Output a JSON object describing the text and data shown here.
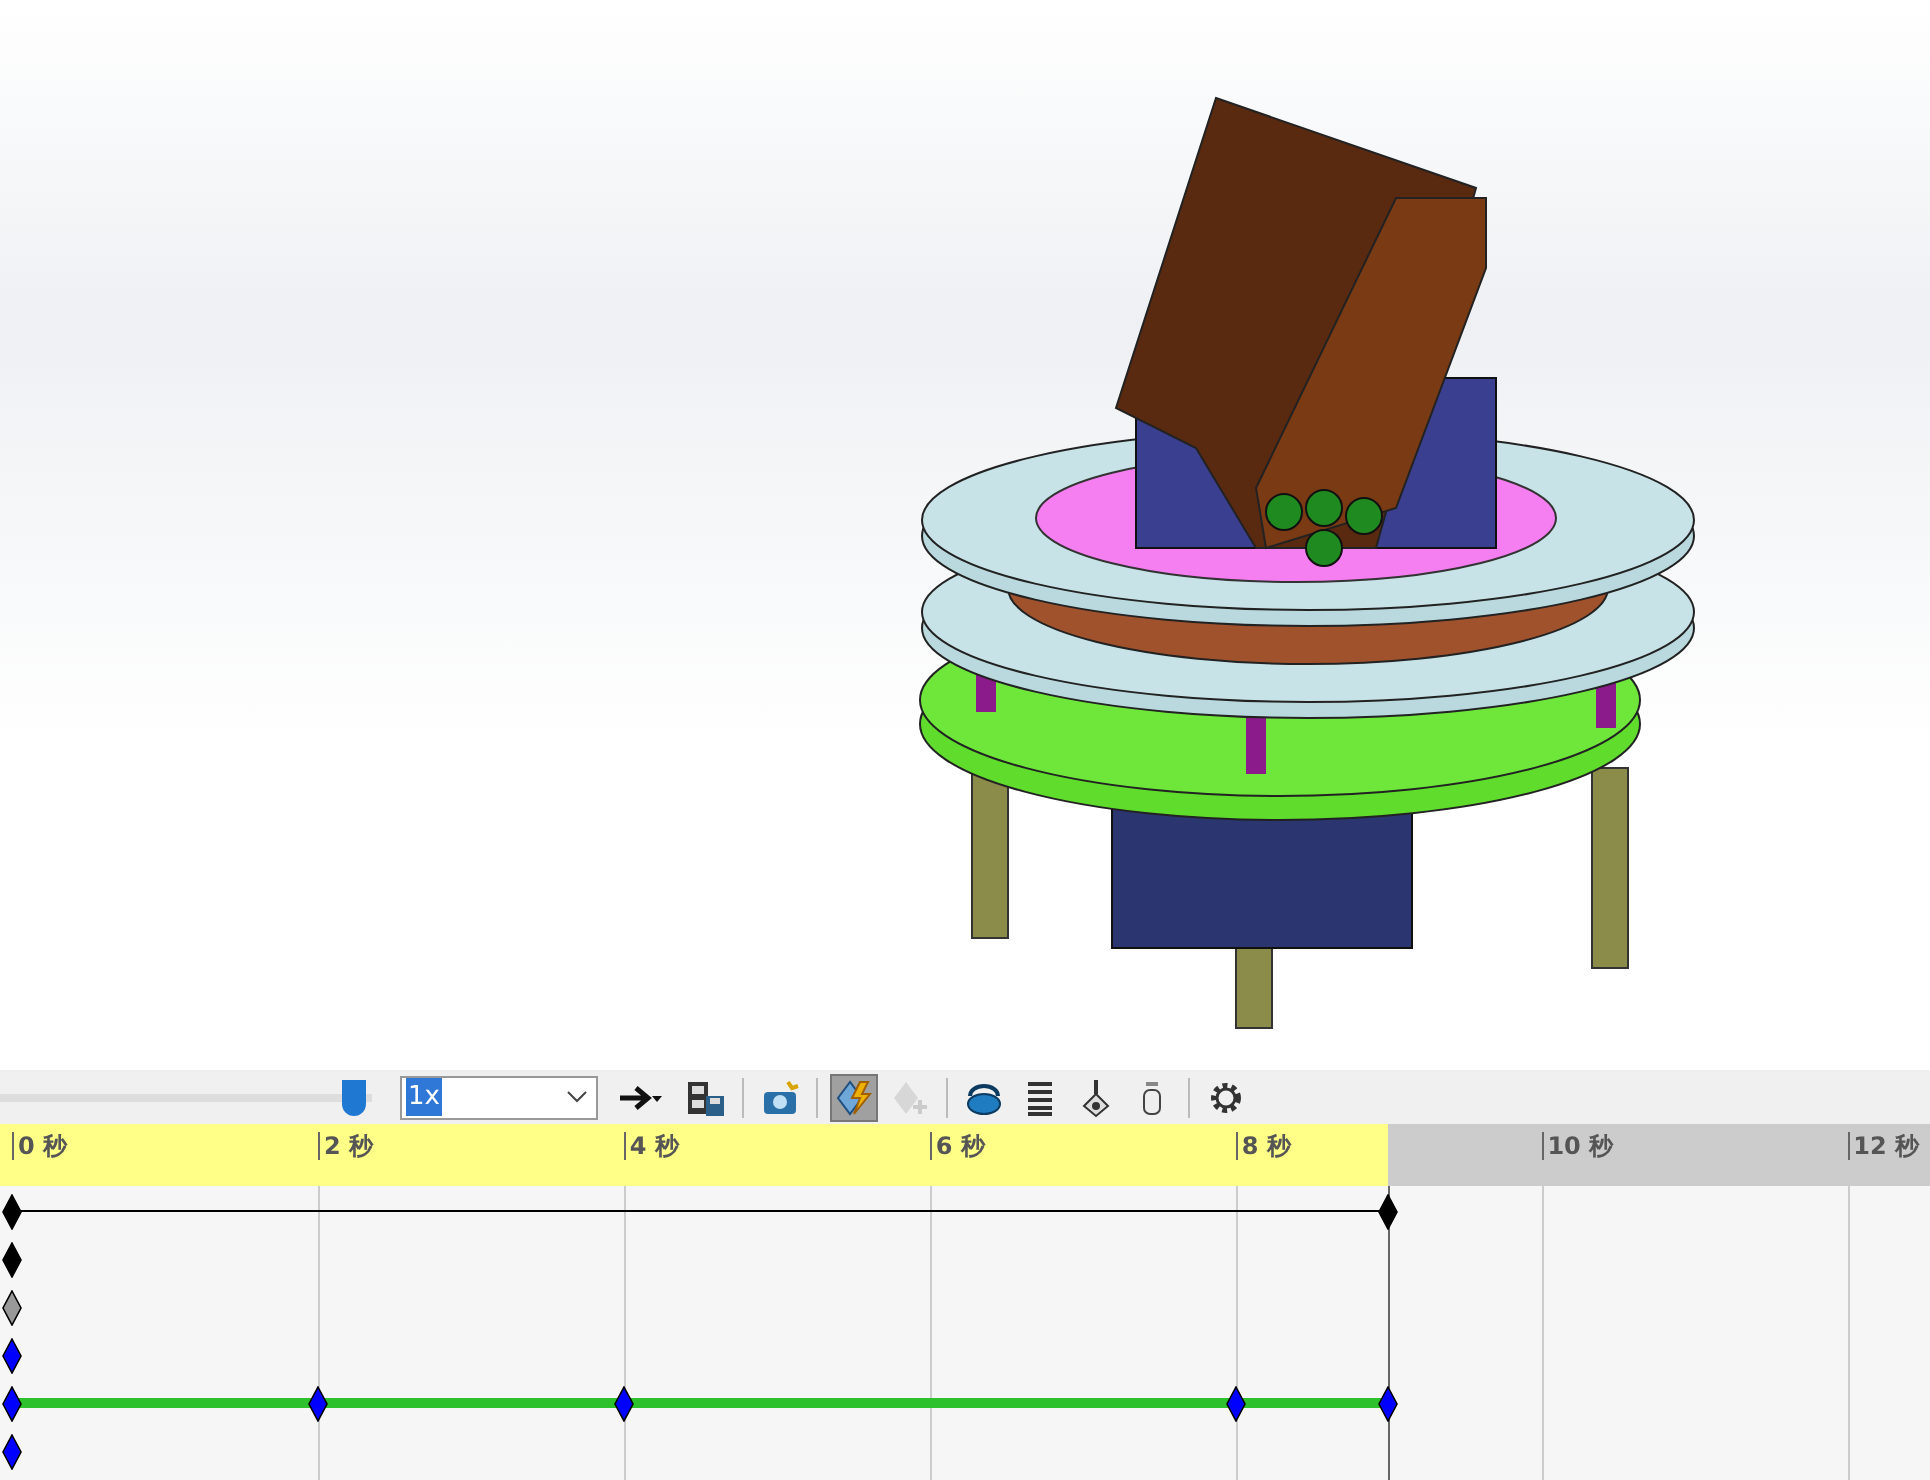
{
  "toolbar": {
    "slider": {
      "level": 0.98
    },
    "speed": {
      "value": "1x"
    },
    "tools": [
      {
        "kind": "play-arrow",
        "selected": false,
        "disabled": false
      },
      {
        "kind": "save-film",
        "selected": false,
        "disabled": false
      },
      {
        "kind": "camera",
        "selected": false,
        "disabled": false
      },
      {
        "kind": "autokey",
        "selected": true,
        "disabled": false
      },
      {
        "kind": "add-key",
        "selected": false,
        "disabled": true
      },
      {
        "kind": "motor",
        "selected": false,
        "disabled": false
      },
      {
        "kind": "spring",
        "selected": false,
        "disabled": false
      },
      {
        "kind": "contact",
        "selected": false,
        "disabled": false
      },
      {
        "kind": "gravity",
        "selected": false,
        "disabled": false
      },
      {
        "kind": "settings",
        "selected": false,
        "disabled": false
      }
    ]
  },
  "timeline": {
    "level": 0.7177,
    "ticks": [
      {
        "label": "0 秒",
        "level": 0
      },
      {
        "label": "2 秒",
        "level": 0.1595
      },
      {
        "label": "4 秒",
        "level": 0.319
      },
      {
        "label": "6 秒",
        "level": 0.4785
      },
      {
        "label": "8 秒",
        "level": 0.638
      },
      {
        "label": "10 秒",
        "level": 0.7974
      },
      {
        "label": "12 秒",
        "level": 0.9569
      }
    ],
    "rows": [
      {
        "kind": "line",
        "keys": [
          {
            "color": "#000000",
            "level": 0
          },
          {
            "color": "#000000",
            "level": 0.7177
          }
        ]
      },
      {
        "kind": "plain",
        "keys": [
          {
            "color": "#000000",
            "level": 0
          }
        ]
      },
      {
        "kind": "plain",
        "keys": [
          {
            "color": "#999999",
            "level": 0
          }
        ]
      },
      {
        "kind": "plain",
        "keys": [
          {
            "color": "#0000ff",
            "level": 0
          }
        ]
      },
      {
        "kind": "green",
        "keys": [
          {
            "color": "#0000ff",
            "level": 0
          },
          {
            "color": "#0000ff",
            "level": 0.1595
          },
          {
            "color": "#0000ff",
            "level": 0.319
          },
          {
            "color": "#0000ff",
            "level": 0.638
          },
          {
            "color": "#0000ff",
            "level": 0.7177
          }
        ]
      },
      {
        "kind": "plain",
        "keys": [
          {
            "color": "#0000ff",
            "level": 0
          }
        ]
      }
    ]
  }
}
